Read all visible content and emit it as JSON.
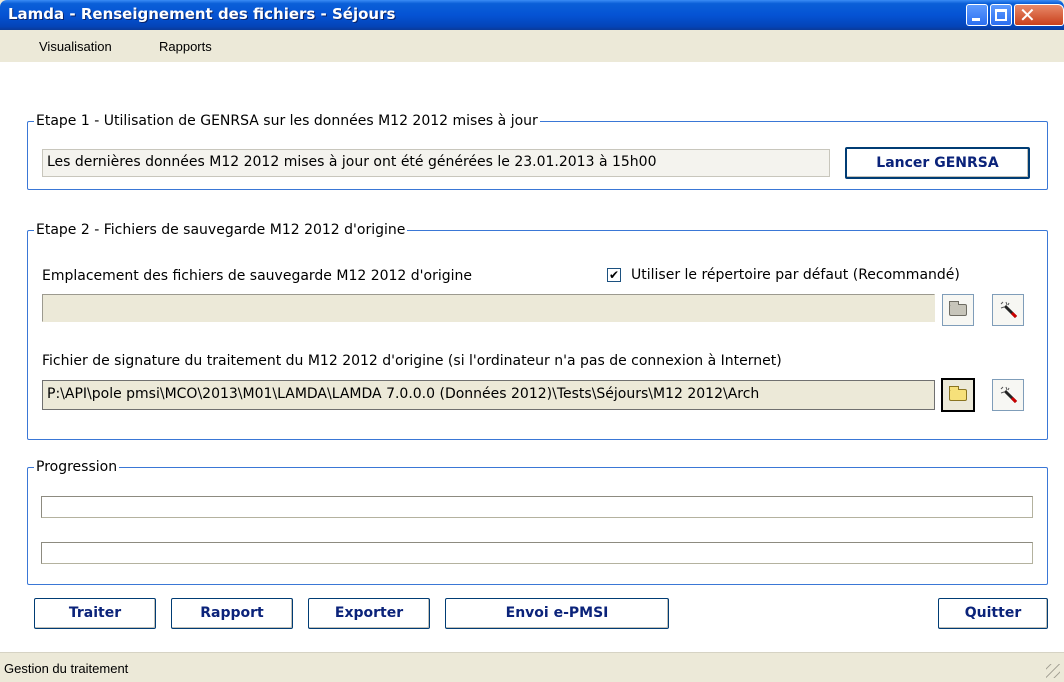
{
  "window": {
    "title": "Lamda - Renseignement des fichiers - Séjours",
    "close_glyph": "✕"
  },
  "menu": {
    "items": [
      "Visualisation",
      "Rapports"
    ]
  },
  "step1": {
    "legend": "Etape 1 - Utilisation de GENRSA sur les données M12 2012 mises à jour",
    "info": "Les dernières données M12 2012 mises à jour ont été générées le 23.01.2013 à 15h00",
    "button_label": "Lancer GENRSA"
  },
  "step2": {
    "legend": "Etape 2 - Fichiers de sauvegarde M12 2012 d'origine",
    "location_label": "Emplacement des fichiers de sauvegarde M12 2012 d'origine",
    "default_dir_checkbox": {
      "label": "Utiliser le répertoire par défaut (Recommandé)",
      "checked": true,
      "mark": "✔"
    },
    "location_value": "",
    "signature_label": "Fichier de signature du traitement du M12 2012 d'origine (si l'ordinateur n'a pas de connexion à Internet)",
    "signature_value": "P:\\API\\pole pmsi\\MCO\\2013\\M01\\LAMDA\\LAMDA 7.0.0.0 (Données 2012)\\Tests\\Séjours\\M12 2012\\Arch"
  },
  "progression": {
    "legend": "Progression"
  },
  "actions": {
    "traiter": "Traiter",
    "rapport": "Rapport",
    "exporter": "Exporter",
    "envoi": "Envoi e-PMSI",
    "quitter": "Quitter"
  },
  "statusbar": {
    "text": "Gestion du traitement"
  },
  "icons": {
    "folder": "folder-icon",
    "clear": "magic-wand-icon"
  },
  "colors": {
    "titlebar": "#0553d4",
    "group_border": "#3a77d6",
    "button_text": "#0b237a",
    "window_bg": "#ece9d8"
  }
}
